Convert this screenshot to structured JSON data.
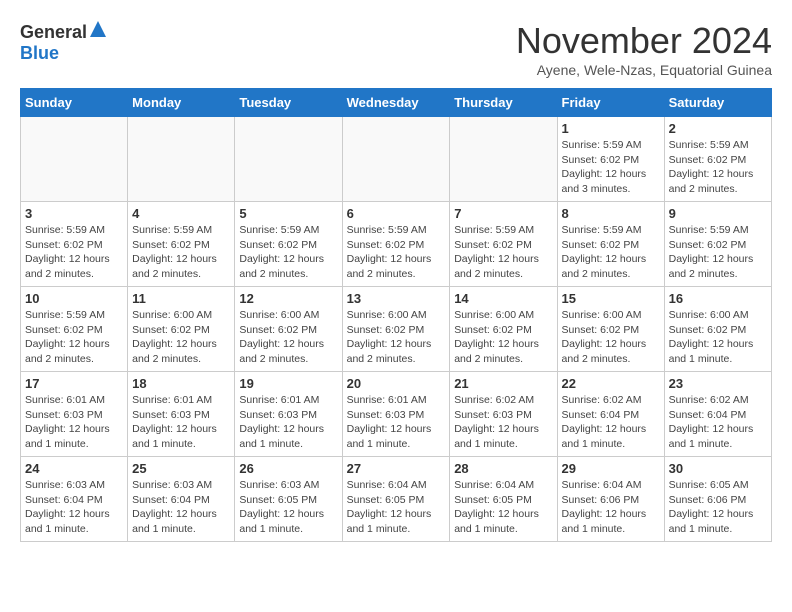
{
  "header": {
    "logo_general": "General",
    "logo_blue": "Blue",
    "month_title": "November 2024",
    "location": "Ayene, Wele-Nzas, Equatorial Guinea"
  },
  "calendar": {
    "days_of_week": [
      "Sunday",
      "Monday",
      "Tuesday",
      "Wednesday",
      "Thursday",
      "Friday",
      "Saturday"
    ],
    "weeks": [
      [
        {
          "day": "",
          "info": ""
        },
        {
          "day": "",
          "info": ""
        },
        {
          "day": "",
          "info": ""
        },
        {
          "day": "",
          "info": ""
        },
        {
          "day": "",
          "info": ""
        },
        {
          "day": "1",
          "info": "Sunrise: 5:59 AM\nSunset: 6:02 PM\nDaylight: 12 hours and 3 minutes."
        },
        {
          "day": "2",
          "info": "Sunrise: 5:59 AM\nSunset: 6:02 PM\nDaylight: 12 hours and 2 minutes."
        }
      ],
      [
        {
          "day": "3",
          "info": "Sunrise: 5:59 AM\nSunset: 6:02 PM\nDaylight: 12 hours and 2 minutes."
        },
        {
          "day": "4",
          "info": "Sunrise: 5:59 AM\nSunset: 6:02 PM\nDaylight: 12 hours and 2 minutes."
        },
        {
          "day": "5",
          "info": "Sunrise: 5:59 AM\nSunset: 6:02 PM\nDaylight: 12 hours and 2 minutes."
        },
        {
          "day": "6",
          "info": "Sunrise: 5:59 AM\nSunset: 6:02 PM\nDaylight: 12 hours and 2 minutes."
        },
        {
          "day": "7",
          "info": "Sunrise: 5:59 AM\nSunset: 6:02 PM\nDaylight: 12 hours and 2 minutes."
        },
        {
          "day": "8",
          "info": "Sunrise: 5:59 AM\nSunset: 6:02 PM\nDaylight: 12 hours and 2 minutes."
        },
        {
          "day": "9",
          "info": "Sunrise: 5:59 AM\nSunset: 6:02 PM\nDaylight: 12 hours and 2 minutes."
        }
      ],
      [
        {
          "day": "10",
          "info": "Sunrise: 5:59 AM\nSunset: 6:02 PM\nDaylight: 12 hours and 2 minutes."
        },
        {
          "day": "11",
          "info": "Sunrise: 6:00 AM\nSunset: 6:02 PM\nDaylight: 12 hours and 2 minutes."
        },
        {
          "day": "12",
          "info": "Sunrise: 6:00 AM\nSunset: 6:02 PM\nDaylight: 12 hours and 2 minutes."
        },
        {
          "day": "13",
          "info": "Sunrise: 6:00 AM\nSunset: 6:02 PM\nDaylight: 12 hours and 2 minutes."
        },
        {
          "day": "14",
          "info": "Sunrise: 6:00 AM\nSunset: 6:02 PM\nDaylight: 12 hours and 2 minutes."
        },
        {
          "day": "15",
          "info": "Sunrise: 6:00 AM\nSunset: 6:02 PM\nDaylight: 12 hours and 2 minutes."
        },
        {
          "day": "16",
          "info": "Sunrise: 6:00 AM\nSunset: 6:02 PM\nDaylight: 12 hours and 1 minute."
        }
      ],
      [
        {
          "day": "17",
          "info": "Sunrise: 6:01 AM\nSunset: 6:03 PM\nDaylight: 12 hours and 1 minute."
        },
        {
          "day": "18",
          "info": "Sunrise: 6:01 AM\nSunset: 6:03 PM\nDaylight: 12 hours and 1 minute."
        },
        {
          "day": "19",
          "info": "Sunrise: 6:01 AM\nSunset: 6:03 PM\nDaylight: 12 hours and 1 minute."
        },
        {
          "day": "20",
          "info": "Sunrise: 6:01 AM\nSunset: 6:03 PM\nDaylight: 12 hours and 1 minute."
        },
        {
          "day": "21",
          "info": "Sunrise: 6:02 AM\nSunset: 6:03 PM\nDaylight: 12 hours and 1 minute."
        },
        {
          "day": "22",
          "info": "Sunrise: 6:02 AM\nSunset: 6:04 PM\nDaylight: 12 hours and 1 minute."
        },
        {
          "day": "23",
          "info": "Sunrise: 6:02 AM\nSunset: 6:04 PM\nDaylight: 12 hours and 1 minute."
        }
      ],
      [
        {
          "day": "24",
          "info": "Sunrise: 6:03 AM\nSunset: 6:04 PM\nDaylight: 12 hours and 1 minute."
        },
        {
          "day": "25",
          "info": "Sunrise: 6:03 AM\nSunset: 6:04 PM\nDaylight: 12 hours and 1 minute."
        },
        {
          "day": "26",
          "info": "Sunrise: 6:03 AM\nSunset: 6:05 PM\nDaylight: 12 hours and 1 minute."
        },
        {
          "day": "27",
          "info": "Sunrise: 6:04 AM\nSunset: 6:05 PM\nDaylight: 12 hours and 1 minute."
        },
        {
          "day": "28",
          "info": "Sunrise: 6:04 AM\nSunset: 6:05 PM\nDaylight: 12 hours and 1 minute."
        },
        {
          "day": "29",
          "info": "Sunrise: 6:04 AM\nSunset: 6:06 PM\nDaylight: 12 hours and 1 minute."
        },
        {
          "day": "30",
          "info": "Sunrise: 6:05 AM\nSunset: 6:06 PM\nDaylight: 12 hours and 1 minute."
        }
      ]
    ]
  }
}
